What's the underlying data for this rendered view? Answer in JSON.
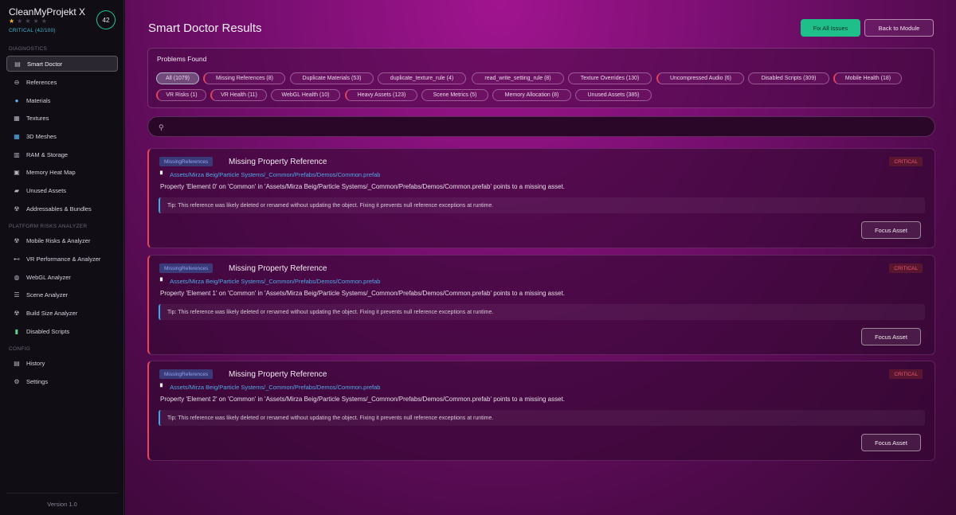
{
  "app": {
    "name": "CleanMyProjekt X",
    "stars_filled": 1,
    "stars_total": 5,
    "health_label": "CRITICAL (42/100)",
    "score": "42",
    "version": "Version 1.0"
  },
  "sidebar": {
    "sections": [
      {
        "title": "DIAGNOSTICS",
        "items": [
          {
            "label": "Smart Doctor",
            "icon": "document-icon",
            "active": true
          },
          {
            "label": "References",
            "icon": "link-icon"
          },
          {
            "label": "Materials",
            "icon": "sphere-icon"
          },
          {
            "label": "Textures",
            "icon": "texture-grid-icon"
          },
          {
            "label": "3D Meshes",
            "icon": "mesh-grid-icon"
          },
          {
            "label": "RAM & Storage",
            "icon": "ram-icon"
          },
          {
            "label": "Memory Heat Map",
            "icon": "heatmap-icon"
          },
          {
            "label": "Unused Assets",
            "icon": "folder-icon"
          },
          {
            "label": "Addressables & Bundles",
            "icon": "radiation-icon"
          }
        ]
      },
      {
        "title": "PLATFORM RISKS ANALYZER",
        "items": [
          {
            "label": "Mobile Risks & Analyzer",
            "icon": "radiation-icon"
          },
          {
            "label": "VR Performance & Analyzer",
            "icon": "vr-icon"
          },
          {
            "label": "WebGL Analyzer",
            "icon": "globe-icon"
          },
          {
            "label": "Scene Analyzer",
            "icon": "scene-icon"
          },
          {
            "label": "Build Size Analyzer",
            "icon": "radiation-icon"
          },
          {
            "label": "Disabled Scripts",
            "icon": "script-icon"
          }
        ]
      },
      {
        "title": "CONFIG",
        "items": [
          {
            "label": "History",
            "icon": "history-icon"
          },
          {
            "label": "Settings",
            "icon": "gear-icon"
          }
        ]
      }
    ]
  },
  "header": {
    "title": "Smart Doctor Results",
    "fix_all_label": "Fix All Issues",
    "back_label": "Back to Module"
  },
  "problems": {
    "title": "Problems Found",
    "chips": [
      {
        "label": "All (1079)",
        "selected": true
      },
      {
        "label": "Missing References (8)",
        "warn": true
      },
      {
        "label": "Duplicate Materials (53)"
      },
      {
        "label": "duplicate_texture_rule (4)"
      },
      {
        "label": "read_write_setting_rule (8)"
      },
      {
        "label": "Texture Overrides (130)"
      },
      {
        "label": "Uncompressed Audio (6)",
        "warn": true
      },
      {
        "label": "Disabled Scripts (309)"
      },
      {
        "label": "Mobile Health (18)",
        "warn": true
      },
      {
        "label": "VR Risks (1)",
        "warn": true
      },
      {
        "label": "VR Health (11)",
        "warn": true
      },
      {
        "label": "WebGL Health (10)"
      },
      {
        "label": "Heavy Assets (123)",
        "warn": true
      },
      {
        "label": "Scene Metrics (5)"
      },
      {
        "label": "Memory Allocation (8)"
      },
      {
        "label": "Unused Assets (385)"
      }
    ]
  },
  "search": {
    "placeholder": "",
    "value": ""
  },
  "issues": [
    {
      "tag": "MissingReferences",
      "title": "Missing Property Reference",
      "severity": "CRITICAL",
      "path": "Assets/Mirza Beig/Particle Systems/_Common/Prefabs/Demos/Common.prefab",
      "description": "Property 'Element 0' on 'Common' in 'Assets/Mirza Beig/Particle Systems/_Common/Prefabs/Demos/Common.prefab' points to a missing asset.",
      "tip": "Tip: This reference was likely deleted or renamed without updating the object. Fixing it prevents null reference exceptions at runtime.",
      "action": "Focus Asset"
    },
    {
      "tag": "MissingReferences",
      "title": "Missing Property Reference",
      "severity": "CRITICAL",
      "path": "Assets/Mirza Beig/Particle Systems/_Common/Prefabs/Demos/Common.prefab",
      "description": "Property 'Element 1' on 'Common' in 'Assets/Mirza Beig/Particle Systems/_Common/Prefabs/Demos/Common.prefab' points to a missing asset.",
      "tip": "Tip: This reference was likely deleted or renamed without updating the object. Fixing it prevents null reference exceptions at runtime.",
      "action": "Focus Asset"
    },
    {
      "tag": "MissingReferences",
      "title": "Missing Property Reference",
      "severity": "CRITICAL",
      "path": "Assets/Mirza Beig/Particle Systems/_Common/Prefabs/Demos/Common.prefab",
      "description": "Property 'Element 2' on 'Common' in 'Assets/Mirza Beig/Particle Systems/_Common/Prefabs/Demos/Common.prefab' points to a missing asset.",
      "tip": "Tip: This reference was likely deleted or renamed without updating the object. Fixing it prevents null reference exceptions at runtime.",
      "action": "Focus Asset"
    }
  ],
  "colors": {
    "accent_green": "#1fbf8a",
    "critical_red": "#e45a6e",
    "link_blue": "#50a9e8",
    "tag_blue": "#8fa4f0",
    "star_gold": "#f4b93c"
  }
}
